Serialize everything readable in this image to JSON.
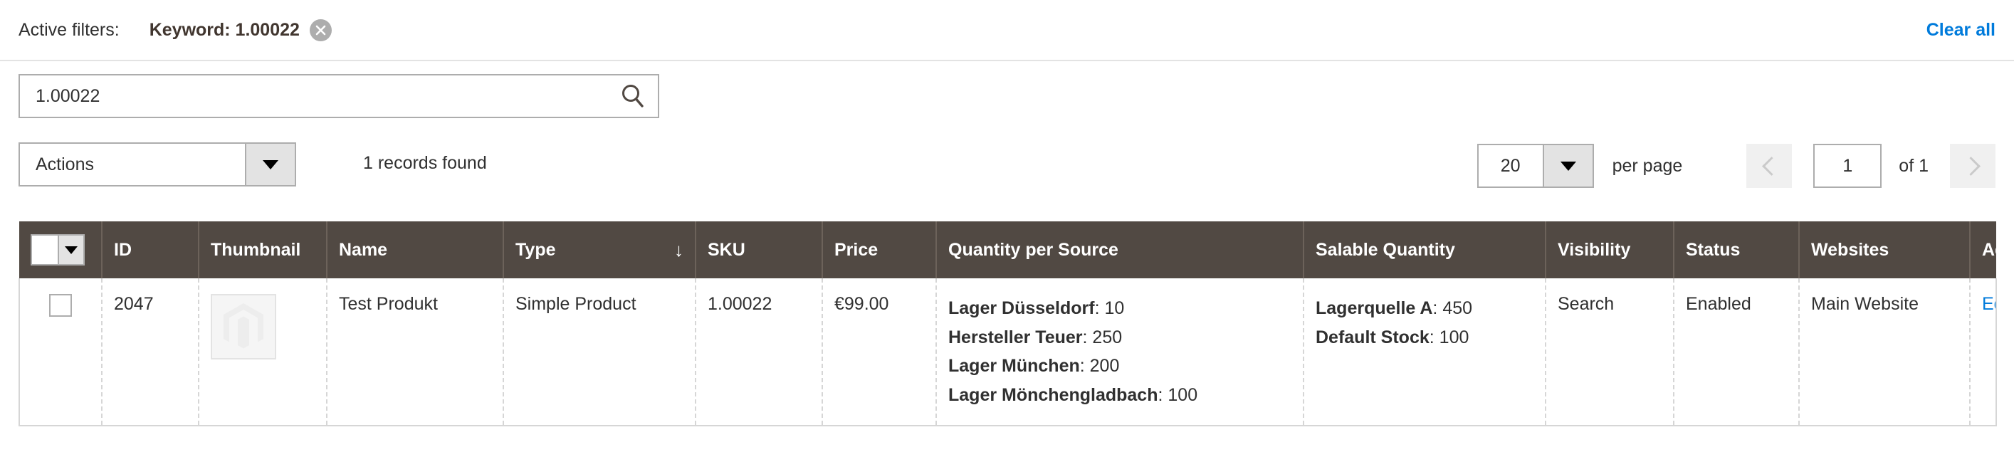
{
  "filters": {
    "label": "Active filters:",
    "chips": [
      {
        "text": "Keyword: 1.00022",
        "remove_icon": "close-circle-icon"
      }
    ],
    "clear_all": "Clear all",
    "accent_link_color": "#007bdb"
  },
  "search": {
    "value": "1.00022",
    "placeholder": "Search by keyword",
    "icon": "search-icon"
  },
  "toolbar": {
    "actions_label": "Actions",
    "records_found": "1 records found"
  },
  "pagination": {
    "per_page_value": "20",
    "per_page_label": "per page",
    "page_value": "1",
    "of_label": "of 1",
    "prev_icon": "chevron-left-icon",
    "next_icon": "chevron-right-icon"
  },
  "grid": {
    "header_bg": "#514943",
    "columns": [
      {
        "key": "checkbox",
        "label": ""
      },
      {
        "key": "id",
        "label": "ID"
      },
      {
        "key": "thumbnail",
        "label": "Thumbnail"
      },
      {
        "key": "name",
        "label": "Name"
      },
      {
        "key": "type",
        "label": "Type",
        "sorted": true,
        "sort_arrow": "↓"
      },
      {
        "key": "sku",
        "label": "SKU"
      },
      {
        "key": "price",
        "label": "Price"
      },
      {
        "key": "qty_per_source",
        "label": "Quantity per Source"
      },
      {
        "key": "salable_qty",
        "label": "Salable Quantity"
      },
      {
        "key": "visibility",
        "label": "Visibility"
      },
      {
        "key": "status",
        "label": "Status"
      },
      {
        "key": "websites",
        "label": "Websites"
      },
      {
        "key": "action",
        "label": "Action"
      }
    ],
    "rows": [
      {
        "id": "2047",
        "thumbnail_icon": "magento-placeholder-icon",
        "name": "Test Produkt",
        "type": "Simple Product",
        "sku": "1.00022",
        "price": "€99.00",
        "qty_per_source": [
          {
            "source": "Lager Düsseldorf",
            "qty": "10"
          },
          {
            "source": "Hersteller Teuer",
            "qty": "250"
          },
          {
            "source": "Lager München",
            "qty": "200"
          },
          {
            "source": "Lager Mönchengladbach",
            "qty": "100"
          }
        ],
        "salable_qty": [
          {
            "source": "Lagerquelle A",
            "qty": "450"
          },
          {
            "source": "Default Stock",
            "qty": "100"
          }
        ],
        "visibility": "Search",
        "status": "Enabled",
        "websites": "Main Website",
        "action": "Edit"
      }
    ]
  }
}
